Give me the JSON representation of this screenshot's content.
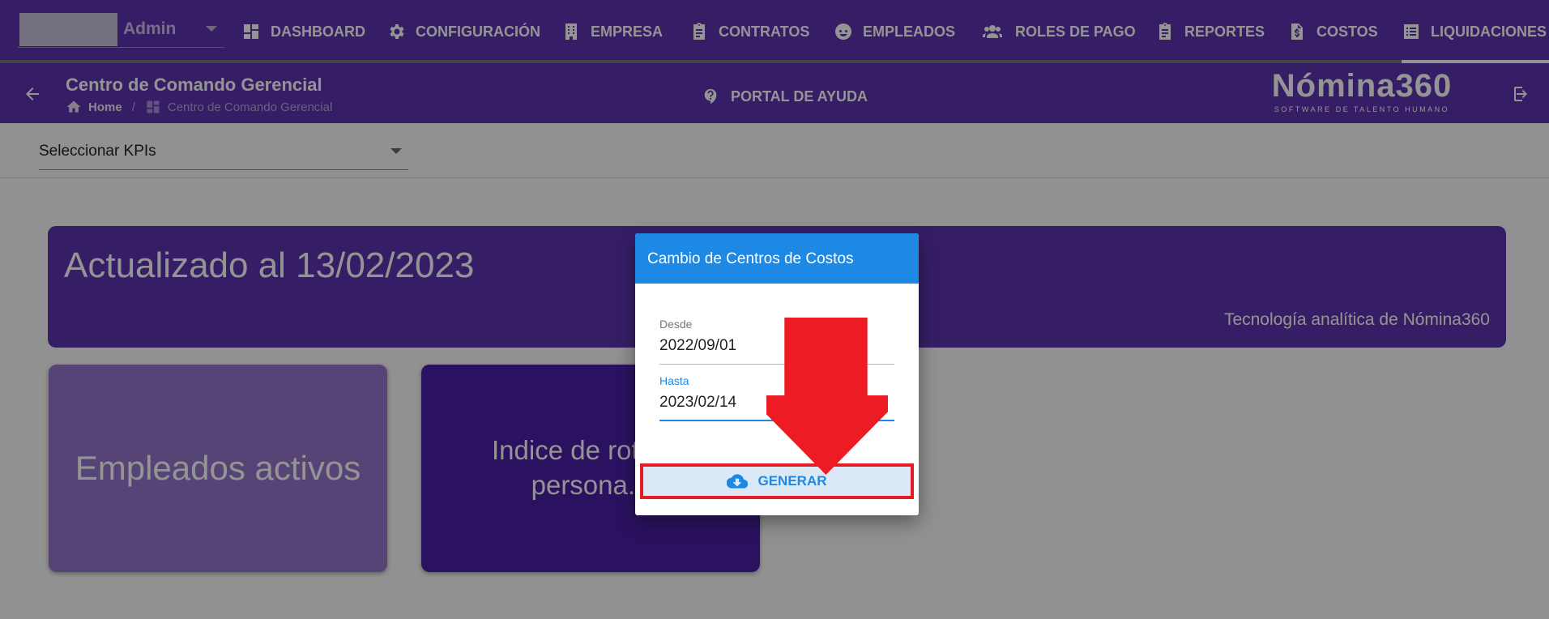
{
  "user": {
    "name": "Admin"
  },
  "nav": {
    "items": [
      {
        "label": "DASHBOARD",
        "icon": "dashboard-icon"
      },
      {
        "label": "CONFIGURACIÓN",
        "icon": "gear-icon"
      },
      {
        "label": "EMPRESA",
        "icon": "building-icon"
      },
      {
        "label": "CONTRATOS",
        "icon": "clipboard-icon"
      },
      {
        "label": "EMPLEADOS",
        "icon": "face-icon"
      },
      {
        "label": "ROLES DE PAGO",
        "icon": "users-icon"
      },
      {
        "label": "REPORTES",
        "icon": "clipboard-icon"
      },
      {
        "label": "COSTOS",
        "icon": "dollar-file-icon"
      },
      {
        "label": "LIQUIDACIONES",
        "icon": "list-icon"
      }
    ],
    "active": "LIQUIDACIONES"
  },
  "header": {
    "title": "Centro de Comando Gerencial",
    "breadcrumb": [
      "Home",
      "Centro de Comando Gerencial"
    ],
    "help_label": "PORTAL DE AYUDA",
    "brand_name": "Nómina360",
    "brand_tagline": "SOFTWARE DE TALENTO HUMANO"
  },
  "kpi_select": {
    "value": "Seleccionar KPIs"
  },
  "banner": {
    "title": "Actualizado al 13/02/2023",
    "subtitle": "Tecnología analítica de Nómina360"
  },
  "cards": [
    {
      "label": "Empleados activos"
    },
    {
      "label": "Indice de rotac... persona..."
    }
  ],
  "dialog": {
    "title": "Cambio de Centros de Costos",
    "desde_label": "Desde",
    "desde_value": "2022/09/01",
    "hasta_label": "Hasta",
    "hasta_value": "2023/02/14",
    "button_label": "GENERAR"
  },
  "colors": {
    "primary": "#5e35b1",
    "accent": "#1e88e5",
    "highlight": "#e51c23"
  }
}
